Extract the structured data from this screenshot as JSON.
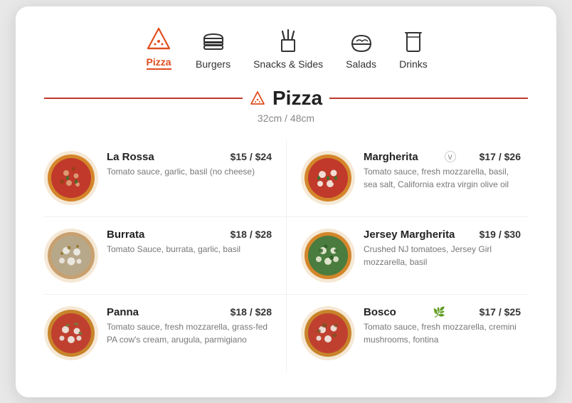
{
  "nav": {
    "items": [
      {
        "id": "pizza",
        "label": "Pizza",
        "active": true
      },
      {
        "id": "burgers",
        "label": "Burgers",
        "active": false
      },
      {
        "id": "snacks",
        "label": "Snacks & Sides",
        "active": false
      },
      {
        "id": "salads",
        "label": "Salads",
        "active": false
      },
      {
        "id": "drinks",
        "label": "Drinks",
        "active": false
      }
    ]
  },
  "section": {
    "title": "Pizza",
    "subtitle": "32cm / 48cm"
  },
  "menu": {
    "items": [
      {
        "id": "la-rossa",
        "name": "La Rossa",
        "price": "$15 / $24",
        "description": "Tomato sauce, garlic, basil (no cheese)",
        "badge": "",
        "col": "left"
      },
      {
        "id": "margherita",
        "name": "Margherita",
        "price": "$17 / $26",
        "description": "Tomato sauce, fresh mozzarella, basil, sea salt, California extra virgin olive oil",
        "badge": "v",
        "col": "right"
      },
      {
        "id": "burrata",
        "name": "Burrata",
        "price": "$18 / $28",
        "description": "Tomato Sauce, burrata, garlic, basil",
        "badge": "",
        "col": "left"
      },
      {
        "id": "jersey-margherita",
        "name": "Jersey Margherita",
        "price": "$19 / $30",
        "description": "Crushed NJ tomatoes, Jersey Girl mozzarella, basil",
        "badge": "",
        "col": "right"
      },
      {
        "id": "panna",
        "name": "Panna",
        "price": "$18 / $28",
        "description": "Tomato sauce, fresh mozzarella, grass-fed PA cow's cream, arugula, parmigiano",
        "badge": "",
        "col": "left"
      },
      {
        "id": "bosco",
        "name": "Bosco",
        "price": "$17 / $25",
        "description": "Tomato sauce, fresh mozzarella, cremini mushrooms, fontina",
        "badge": "leaf",
        "col": "right"
      }
    ]
  }
}
